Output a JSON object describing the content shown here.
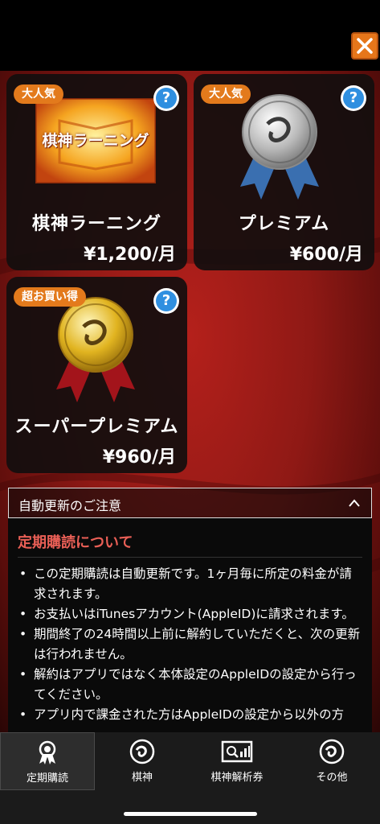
{
  "close_icon": "close-icon",
  "plans": [
    {
      "badge": "大人気",
      "name": "棋神ラーニング",
      "price": "¥1,200/月",
      "art_text": "棋神ラーニング",
      "icon": "book-icon"
    },
    {
      "badge": "大人気",
      "name": "プレミアム",
      "price": "¥600/月",
      "icon": "silver-medal-icon"
    },
    {
      "badge": "超お買い得",
      "name": "スーパープレミアム",
      "price": "¥960/月",
      "icon": "gold-medal-icon"
    }
  ],
  "help_label": "?",
  "notice": {
    "header": "自動更新のご注意",
    "title": "定期購読について",
    "items": [
      "この定期購読は自動更新です。1ヶ月毎に所定の料金が請求されます。",
      "お支払いはiTunesアカウント(AppleID)に請求されます。",
      "期間終了の24時間以上前に解約していただくと、次の更新は行われません。",
      "解約はアプリではなく本体設定のAppleIDの設定から行ってください。",
      "アプリ内で課金された方はAppleIDの設定から以外の方"
    ]
  },
  "tabs": [
    {
      "label": "定期購読",
      "icon": "ribbon-icon",
      "active": true
    },
    {
      "label": "棋神",
      "icon": "kishin-icon"
    },
    {
      "label": "棋神解析券",
      "icon": "ticket-icon"
    },
    {
      "label": "その他",
      "icon": "kishin-icon"
    }
  ],
  "colors": {
    "badge": "#e37a1c",
    "accent_title": "#e95f56",
    "help": "#2f8fe0",
    "background": "#8f1915"
  }
}
